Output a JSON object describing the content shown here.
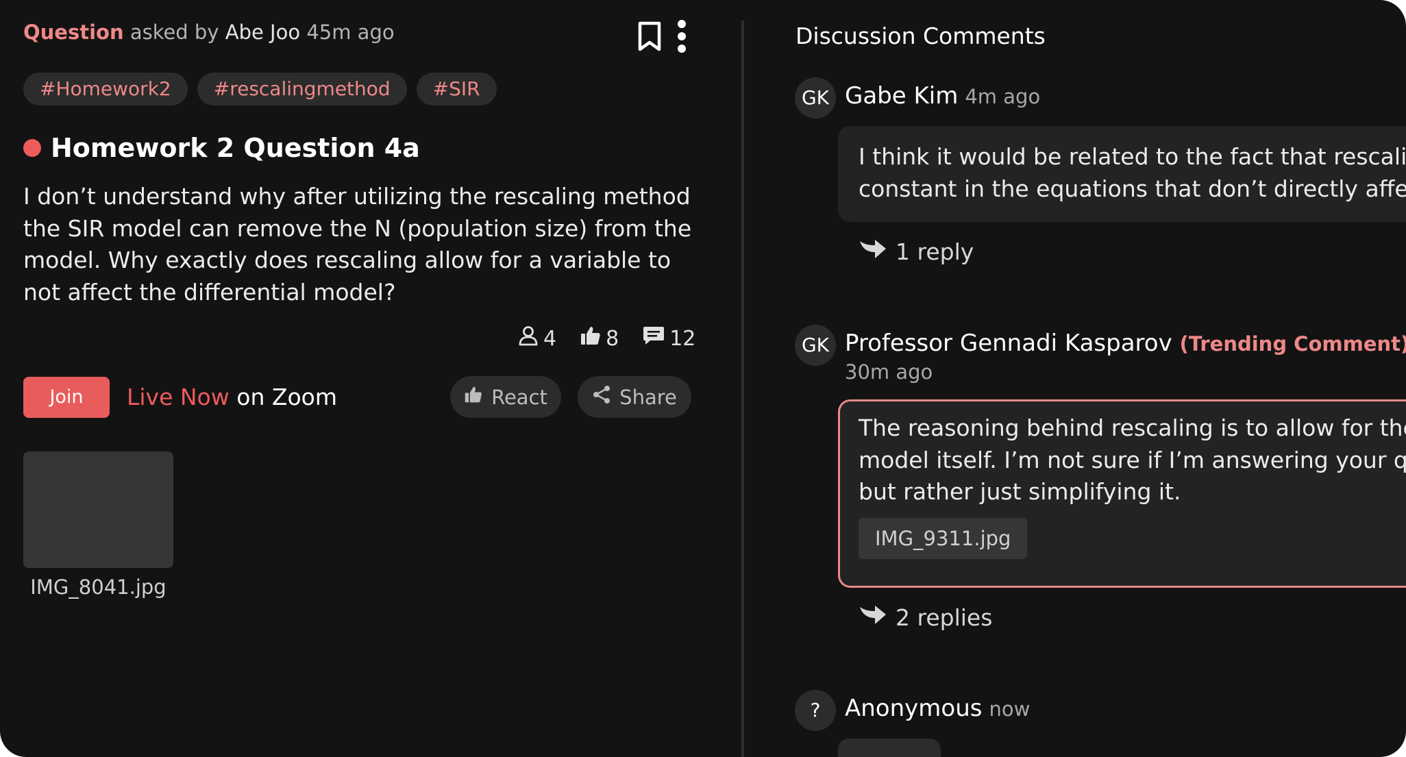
{
  "question": {
    "kind_label": "Question",
    "asked_by_text": "asked by",
    "author": "Abe Joo",
    "time": "45m ago",
    "tags": [
      "#Homework2",
      "#rescalingmethod",
      "#SIR"
    ],
    "title": "Homework 2 Question 4a",
    "body": "I don’t understand why after utilizing the rescaling method the SIR model can remove the N (population size) from the model. Why exactly does rescaling allow for a variable to not affect the differential model?",
    "stats": {
      "participants": "4",
      "likes": "8",
      "comments": "12"
    },
    "join_label": "Join",
    "live_label": "Live Now",
    "on_label": "on Zoom",
    "react_label": "React",
    "share_label": "Share",
    "attachment_name": "IMG_8041.jpg"
  },
  "discussion": {
    "title": "Discussion Comments",
    "comments": [
      {
        "initials": "GK",
        "name": "Gabe Kim",
        "time": "4m ago",
        "lines": [
          "I think it would be related to the fact that rescaling",
          "constant in the equations that don’t directly affect"
        ],
        "replies": "1 reply"
      },
      {
        "initials": "GK",
        "name": "Professor Gennadi Kasparov",
        "badge": "(Trending Comment)",
        "time": "30m ago",
        "lines": [
          "The reasoning behind rescaling is to allow for the c",
          "model itself. I’m not sure if I’m answering your que",
          "but rather just simplifying it."
        ],
        "attachment": "IMG_9311.jpg",
        "replies": "2 replies"
      },
      {
        "initials": "?",
        "name": "Anonymous",
        "time": "now"
      }
    ]
  },
  "colors": {
    "accent": "#ee5b5b",
    "tag_text": "#ee8888",
    "background": "#131313",
    "pill": "#2c2c2c"
  },
  "icons": [
    "bookmark-icon",
    "more-vertical-icon",
    "user-icon",
    "thumbs-up-icon",
    "comment-icon",
    "share-icon",
    "reply-arrow-icon"
  ]
}
